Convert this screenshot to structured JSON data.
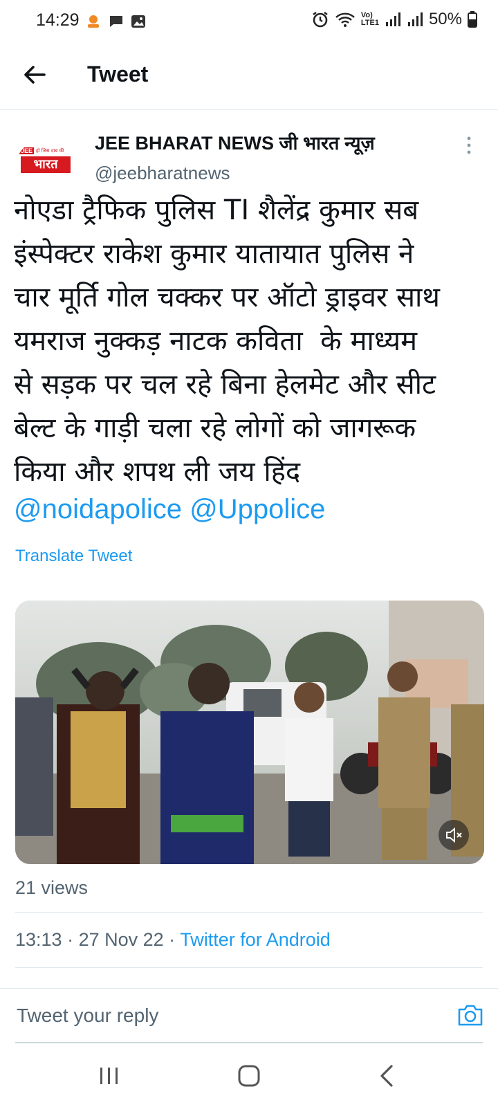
{
  "status_bar": {
    "time": "14:29",
    "battery": "50%",
    "net_label_top": "Vo)",
    "net_label_bottom": "LTE1",
    "icons": [
      "notification-icon",
      "chat-icon",
      "gallery-icon",
      "alarm-icon",
      "wifi-icon",
      "signal-icon",
      "signal-icon",
      "battery-icon"
    ]
  },
  "app_bar": {
    "title": "Tweet",
    "back_icon": "arrow-left-icon"
  },
  "tweet": {
    "author_name": "JEE BHARAT NEWS जी भारत न्यूज़",
    "author_handle": "@jeebharatnews",
    "avatar_text_top": "JEE",
    "avatar_text_small": "हो जिस दाब की",
    "avatar_text_main": "भारत",
    "text": "नोएडा ट्रैफिक पुलिस TI शैलेंद्र कुमार सब\nइंस्पेक्टर राकेश कुमार यातायात पुलिस ने\nचार मूर्ति गोल चक्कर पर ऑटो ड्राइवर साथ\nयमराज नुक्कड़ नाटक कविता  के माध्यम\nसे सड़क पर चल रहे बिना हेलमेट और सीट\nबेल्ट के गाड़ी चला रहे लोगों को जागरूक\nकिया और शपथ ली जय हिंद",
    "mentions": [
      "@noidapolice",
      "@Uppolice"
    ],
    "translate_label": "Translate Tweet",
    "views": "21 views",
    "time": "13:13",
    "date": "27 Nov 22",
    "source": "Twitter for Android",
    "separator": " · "
  },
  "reply": {
    "placeholder": "Tweet your reply"
  },
  "colors": {
    "accent": "#1d9bf0",
    "text": "#0f1419",
    "secondary": "#536471",
    "brand_red": "#d71920"
  }
}
